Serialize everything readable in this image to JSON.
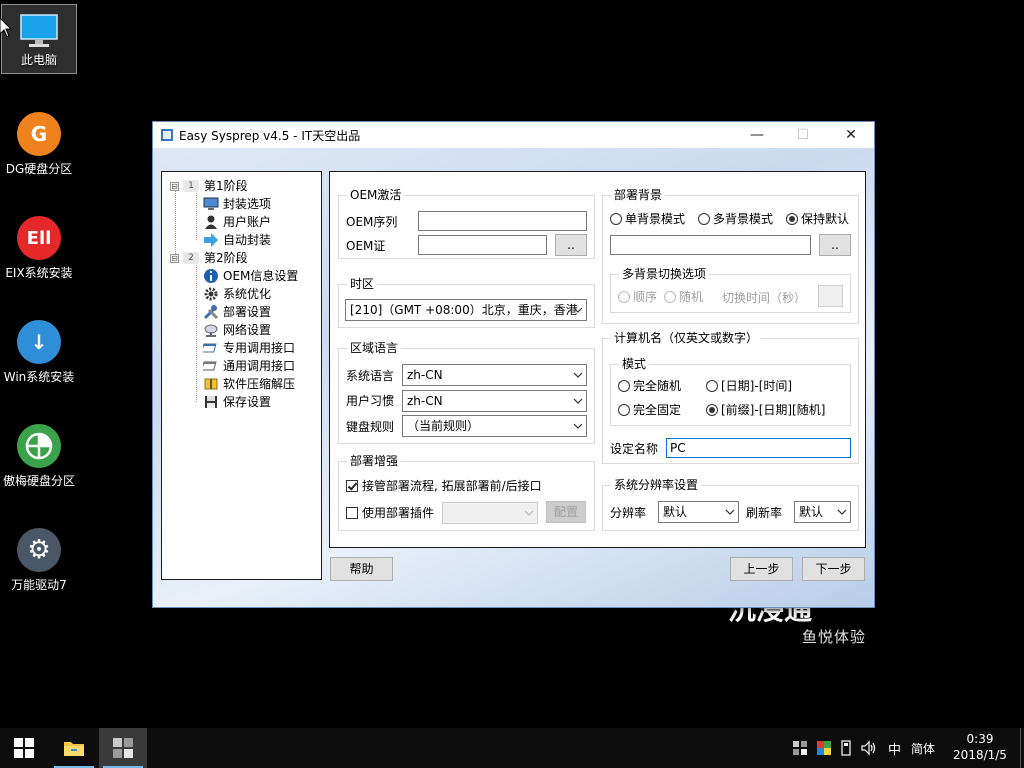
{
  "desktop": {
    "icons": [
      {
        "label": "此电脑"
      },
      {
        "label": "DG硬盘分区",
        "glyph": "G",
        "color": "#f0821e"
      },
      {
        "label": "EIX系统安装",
        "glyph": "Ell",
        "color": "#e5282a"
      },
      {
        "label": "Win系统安装",
        "glyph": "↓",
        "color": "#2e8ed8"
      },
      {
        "label": "傲梅硬盘分区",
        "glyph": "",
        "color": "#3aa24a"
      },
      {
        "label": "万能驱动7",
        "glyph": "⚙",
        "color": "#4a5766"
      }
    ],
    "brand_text": "鱼悦体验",
    "brand_big": "沉浸通"
  },
  "window": {
    "title": "Easy Sysprep v4.5 - IT天空出品",
    "minimize": "—",
    "maximize": "☐",
    "close": "✕"
  },
  "tree": {
    "stage1": {
      "num": "1",
      "label": "第1阶段",
      "toggle": "⊟"
    },
    "stage1_items": [
      "封装选项",
      "用户账户",
      "自动封装"
    ],
    "stage2": {
      "num": "2",
      "label": "第2阶段",
      "toggle": "⊟"
    },
    "stage2_items": [
      "OEM信息设置",
      "系统优化",
      "部署设置",
      "网络设置",
      "专用调用接口",
      "通用调用接口",
      "软件压缩解压",
      "保存设置"
    ]
  },
  "oem": {
    "title": "OEM激活",
    "serial_label": "OEM序列",
    "serial_value": "",
    "cert_label": "OEM证",
    "cert_value": "",
    "browse": ".."
  },
  "timezone": {
    "title": "时区",
    "selected": "[210]（GMT +08:00）北京，重庆，香港"
  },
  "locale": {
    "title": "区域语言",
    "sys_lang_label": "系统语言",
    "sys_lang_value": "zh-CN",
    "user_habit_label": "用户习惯",
    "user_habit_value": "zh-CN",
    "keyboard_label": "键盘规则",
    "keyboard_value": "（当前规则）"
  },
  "deploy_enhance": {
    "title": "部署增强",
    "takeover_label": "接管部署流程, 拓展部署前/后接口",
    "takeover_checked": true,
    "plugin_label": "使用部署插件",
    "plugin_checked": false,
    "plugin_value": "",
    "config_button": "配置"
  },
  "background": {
    "title": "部署背景",
    "single": "单背景模式",
    "multi": "多背景模式",
    "keep_default": "保持默认",
    "selected": "keep_default",
    "path_value": "",
    "browse": "..",
    "switch_title": "多背景切换选项",
    "order": "顺序",
    "random": "随机",
    "switch_time_label": "切换时间（秒）",
    "switch_time_value": ""
  },
  "computer_name": {
    "title": "计算机名（仅英文或数字）",
    "mode_title": "模式",
    "full_random": "完全随机",
    "date_time": "[日期]-[时间]",
    "full_fixed": "完全固定",
    "prefix_date_random": "[前缀]-[日期][随机]",
    "selected": "prefix_date_random",
    "set_name_label": "设定名称",
    "set_name_value": "PC"
  },
  "resolution": {
    "title": "系统分辨率设置",
    "res_label": "分辨率",
    "res_value": "默认",
    "refresh_label": "刷新率",
    "refresh_value": "默认"
  },
  "buttons": {
    "help": "帮助",
    "prev": "上一步",
    "next": "下一步"
  },
  "taskbar": {
    "ime": "中",
    "lang": "简体",
    "time": "0:39",
    "date": "2018/1/5"
  },
  "colors": {
    "accent": "#0078d7",
    "taskbar_bg": "#0d0d0d",
    "window_border": "#6d8fbf"
  }
}
